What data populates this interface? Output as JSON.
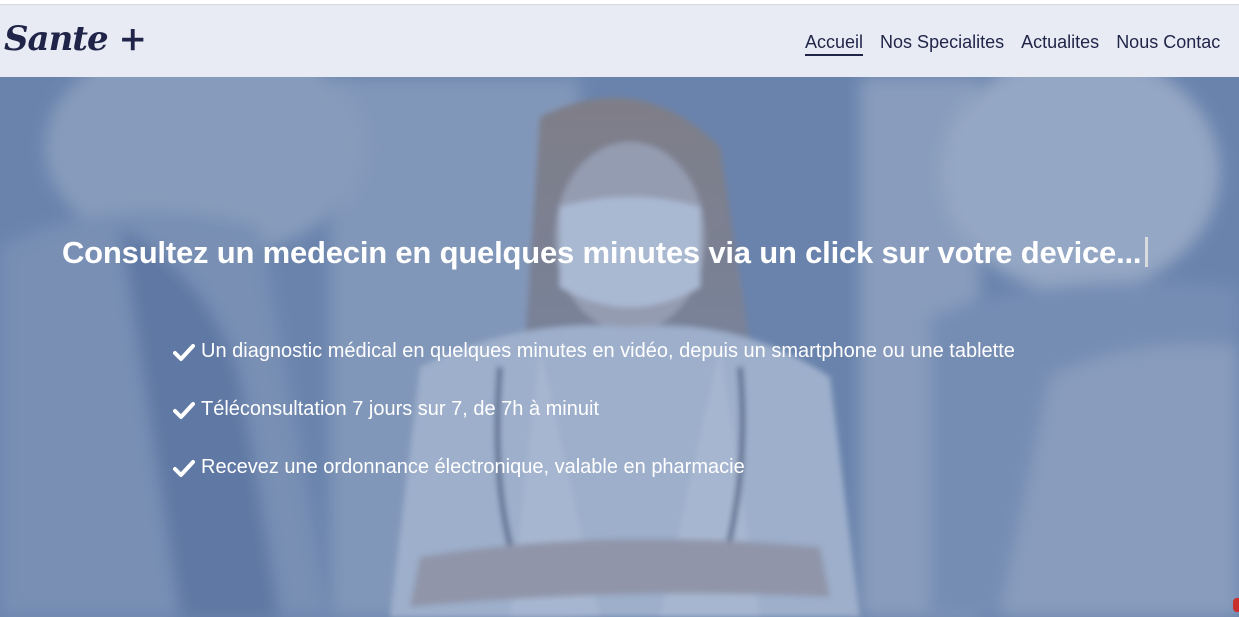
{
  "brand": {
    "logo_text": "Sante +"
  },
  "nav": {
    "items": [
      {
        "label": "Accueil",
        "active": true
      },
      {
        "label": "Nos Specialites",
        "active": false
      },
      {
        "label": "Actualites",
        "active": false
      },
      {
        "label": "Nous Contac",
        "active": false
      }
    ]
  },
  "hero": {
    "headline": "Consultez un medecin en quelques minutes via un click sur votre device...",
    "features": [
      {
        "icon": "check-icon",
        "text": "Un diagnostic médical en quelques minutes en vidéo, depuis un smartphone ou une tablette"
      },
      {
        "icon": "check-icon",
        "text": "Téléconsultation 7 jours sur 7, de 7h à minuit"
      },
      {
        "icon": "check-icon",
        "text": "Recevez une ordonnance électronique, valable en pharmacie"
      }
    ]
  },
  "colors": {
    "navbar_bg": "#e9ebf4",
    "brand_text": "#1f2448",
    "hero_overlay": "#35558c",
    "hero_text": "#ffffff"
  }
}
